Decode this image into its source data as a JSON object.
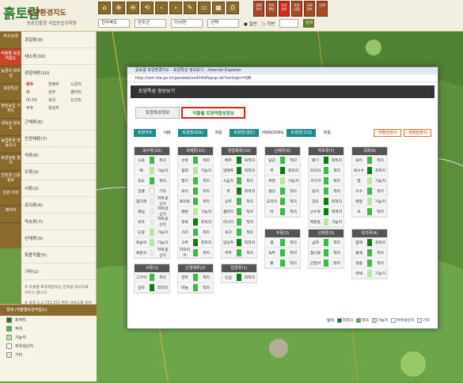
{
  "header": {
    "logo_mark": "흙토람",
    "title": "토양환경지도",
    "subtitle": "농촌진흥청 국립농업과학원"
  },
  "toolbar": {
    "icons": [
      "⌂",
      "⊕",
      "⊖",
      "⟲",
      "‹",
      "›",
      "✎",
      "▭",
      "▦",
      "⎙"
    ],
    "buttons": [
      "범례 보기",
      "위치 확인",
      "토양 정보",
      "토양 검정",
      "기타 정보",
      "인쇄"
    ]
  },
  "nav": {
    "sido": "전라북도",
    "sigungu": "완주군",
    "eupmyeon": "이서면",
    "ri": "선택",
    "radio1": "일반",
    "radio2": "지번",
    "go": "검색"
  },
  "lnav": [
    "주소검색",
    "작물별 토양적합도",
    "농경지 화학성",
    "토양특성",
    "정밀농업 기후도",
    "생육실 분포도",
    "농업환경 변동조사",
    "토양검정 필지",
    "친환경 인증정보",
    "민원 이력",
    "제어어"
  ],
  "lpanel": {
    "items": [
      "과일류(9)",
      "채소류(10)",
      "경엽채류(10)"
    ],
    "subgrid": [
      "배추",
      "양배추",
      "시금치",
      "파",
      "상추",
      "셀러리",
      "미나리",
      "쑥갓",
      "신선초",
      "부추",
      "양상추",
      ""
    ],
    "rest": [
      "근채류(6)",
      "인경채류(7)",
      "곡류(6)",
      "두류(3)",
      "서류(2)",
      "유지류(4)",
      "약초류(7)",
      "산채류(3)",
      "특용작물(5)",
      "기타(1)"
    ],
    "note1": "※ 작물별 토양적합도는 전국을 대상으로 서비스 합니다.",
    "note2": "※ 축척 1:1,733,372 부터 서비스를 지원합니다."
  },
  "legend": {
    "title": "범례 (작물별토양적합도)",
    "tab2": "작물별토양적합도",
    "items": [
      "최적지",
      "적지",
      "가능지",
      "저위생산지",
      "기타"
    ]
  },
  "popup": {
    "title": "흙토람 토양환경지도 - 토양특성 정보보기 - Internet Explorer",
    "url": "http://soil.rda.go.kr/geoweb/soilInfoPopup.do?soilsign=HJB",
    "head": "토양특성 정보보기",
    "tabs": [
      "토양특성정보",
      "작물별 토양적합성정보"
    ],
    "filters": [
      [
        "토양부호",
        "HJB"
      ],
      [
        "토양형(표토)",
        "화동"
      ],
      [
        "토양형(영문)",
        "HWADONG"
      ],
      [
        "토양형(국내)",
        "화동"
      ]
    ],
    "btns": [
      "작물설명서",
      "재배설명서"
    ]
  },
  "chart_data": {
    "type": "table",
    "categories": [
      {
        "name": "과수류(10)",
        "rows": [
          [
            "사과",
            2,
            "적지"
          ],
          [
            "배",
            3,
            "가능지"
          ],
          [
            "포도",
            2,
            "적지"
          ],
          [
            "감귤",
            4,
            "기타"
          ],
          [
            "참다래",
            5,
            "저위생산지"
          ],
          [
            "매실",
            5,
            "저위생산지"
          ],
          [
            "유자",
            5,
            "저위생산지"
          ],
          [
            "단감",
            3,
            "가능지"
          ],
          [
            "복숭아",
            3,
            "가능지"
          ],
          [
            "복분자",
            5,
            "저위생산지"
          ]
        ]
      },
      {
        "name": "과채류(10)",
        "rows": [
          [
            "수박",
            2,
            "적지"
          ],
          [
            "참외",
            3,
            "가능지"
          ],
          [
            "딸기",
            2,
            "적지"
          ],
          [
            "오이",
            2,
            "적지"
          ],
          [
            "토마토",
            2,
            "적지"
          ],
          [
            "메론",
            3,
            "가능지"
          ],
          [
            "호박",
            1,
            "최적지"
          ],
          [
            "가지",
            2,
            "적지"
          ],
          [
            "고추",
            1,
            "최적지"
          ],
          [
            "파프리카",
            2,
            "적지"
          ]
        ]
      },
      {
        "name": "경엽채류(10)",
        "rows": [
          [
            "배추",
            1,
            "최적지"
          ],
          [
            "양배추",
            1,
            "최적지"
          ],
          [
            "시금치",
            2,
            "적지"
          ],
          [
            "파",
            1,
            "최적지"
          ],
          [
            "상추",
            2,
            "적지"
          ],
          [
            "셀러리",
            2,
            "적지"
          ],
          [
            "미나리",
            2,
            "적지"
          ],
          [
            "쑥갓",
            2,
            "적지"
          ],
          [
            "양상추",
            1,
            "최적지"
          ],
          [
            "부추",
            2,
            "적지"
          ]
        ]
      },
      {
        "name": "근채류(6)",
        "rows": [
          [
            "당근",
            2,
            "적지"
          ],
          [
            "무",
            1,
            "최적지"
          ],
          [
            "우엉",
            3,
            "가능지"
          ],
          [
            "생강",
            2,
            "적지"
          ],
          [
            "도라지",
            2,
            "적지"
          ],
          [
            "마",
            2,
            "적지"
          ]
        ]
      },
      {
        "name": "약초류(7)",
        "rows": [
          [
            "황기",
            1,
            "최적지"
          ],
          [
            "오미자",
            2,
            "적지"
          ],
          [
            "구기자",
            2,
            "적지"
          ],
          [
            "당귀",
            2,
            "적지"
          ],
          [
            "감초",
            1,
            "최적지"
          ],
          [
            "산수유",
            1,
            "최적지"
          ],
          [
            "백운동",
            3,
            "가능지"
          ]
        ]
      },
      {
        "name": "곡류(6)",
        "rows": [
          [
            "보리",
            2,
            "적지"
          ],
          [
            "옥수수",
            1,
            "최적지"
          ],
          [
            "밀",
            3,
            "가능지"
          ],
          [
            "수수",
            2,
            "적지"
          ],
          [
            "메밀",
            3,
            "가능지"
          ],
          [
            "조",
            2,
            "적지"
          ]
        ]
      },
      {
        "name": "서류(2)",
        "rows": [
          [
            "고구마",
            2,
            "적지"
          ],
          [
            "감자",
            1,
            "최적지"
          ]
        ]
      },
      {
        "name": "인경채류(2)",
        "rows": [
          [
            "양파",
            2,
            "적지"
          ],
          [
            "마늘",
            2,
            "적지"
          ]
        ]
      },
      {
        "name": "엽경류(1)",
        "rows": [
          [
            "인삼",
            1,
            "최적지"
          ]
        ]
      },
      {
        "name": "두류(3)",
        "rows": [
          [
            "콩",
            2,
            "적지"
          ],
          [
            "녹두",
            2,
            "적지"
          ],
          [
            "팥",
            2,
            "적지"
          ]
        ]
      },
      {
        "name": "산채류(3)",
        "rows": [
          [
            "곰취",
            2,
            "적지"
          ],
          [
            "참나물",
            2,
            "적지"
          ],
          [
            "곤달비",
            2,
            "적지"
          ]
        ]
      },
      {
        "name": "유지류(4)",
        "rows": [
          [
            "참깨",
            1,
            "최적지"
          ],
          [
            "들깨",
            2,
            "적지"
          ],
          [
            "땅콩",
            2,
            "적지"
          ],
          [
            "유채",
            3,
            "가능지"
          ]
        ]
      }
    ],
    "legend": [
      "최적지",
      "적지",
      "가능지",
      "저위생산지",
      "기타"
    ],
    "legend_label": "범례"
  },
  "colors": {
    "c1": "#0b7d10",
    "c2": "#3cb94a",
    "c3": "#b6e8a0",
    "c4": "#ffffff",
    "c5": "#e8e8e8"
  }
}
